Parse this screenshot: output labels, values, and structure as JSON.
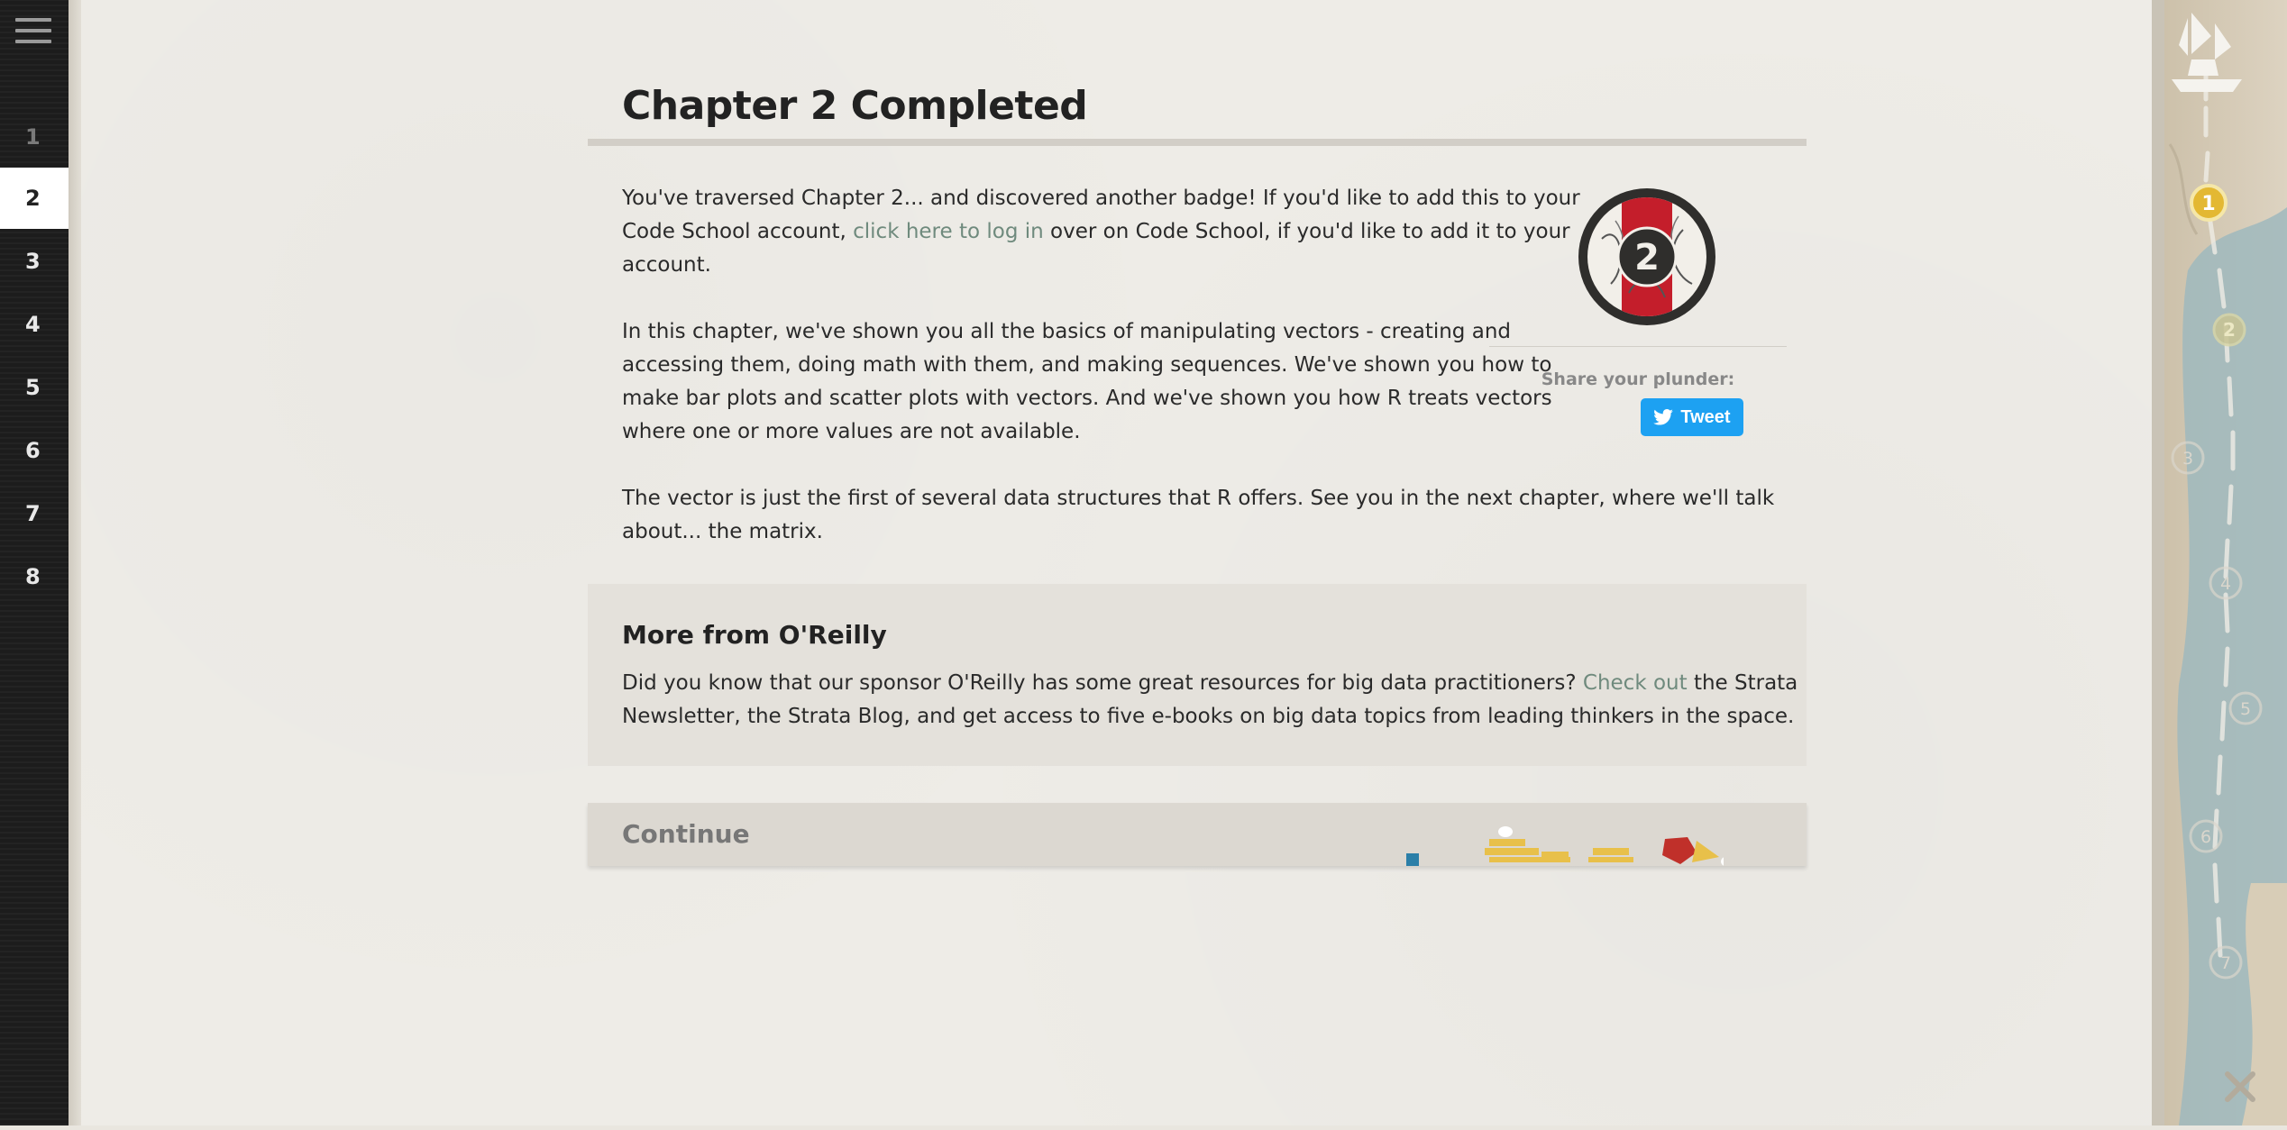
{
  "nav": {
    "chapters": [
      "1",
      "2",
      "3",
      "4",
      "5",
      "6",
      "7",
      "8"
    ],
    "active_chapter": "2"
  },
  "page": {
    "title": "Chapter 2 Completed",
    "intro_part1": "You've traversed Chapter 2... and discovered another badge! If you'd like to add this to your",
    "intro_part2": "Code School account,",
    "intro_link": "click here to log in",
    "intro_part3": "over on Code School, if you'd like to add it to your",
    "intro_part4": "account.",
    "summary_line1": "In this chapter, we've shown you all the basics of manipulating vectors - creating and",
    "summary_line2": "accessing them, doing math with them, and making sequences. We've shown you how to",
    "summary_line3": "make bar plots and scatter plots with vectors. And we've shown you how R treats vectors",
    "summary_line4": "where one or more values are not available.",
    "next_line1": "The vector is just the first of several data structures that R offers. See you in the next chapter, where we'll talk",
    "next_line2": "about... the matrix."
  },
  "badge": {
    "number": "2",
    "share_label": "Share your plunder:",
    "tweet_label": "Tweet"
  },
  "oreilly": {
    "heading": "More from O'Reilly",
    "text_part1": "Did you know that our sponsor O'Reilly has some great resources for big data practitioners?",
    "link": "Check out",
    "text_part2": "the Strata",
    "text_line2": "Newsletter, the Strata Blog, and get access to five e-books on big data topics from leading thinkers in the space."
  },
  "continue_label": "Continue",
  "map": {
    "markers": [
      "1",
      "2",
      "3",
      "4",
      "5",
      "6",
      "7"
    ],
    "close_icon": "close-icon"
  }
}
